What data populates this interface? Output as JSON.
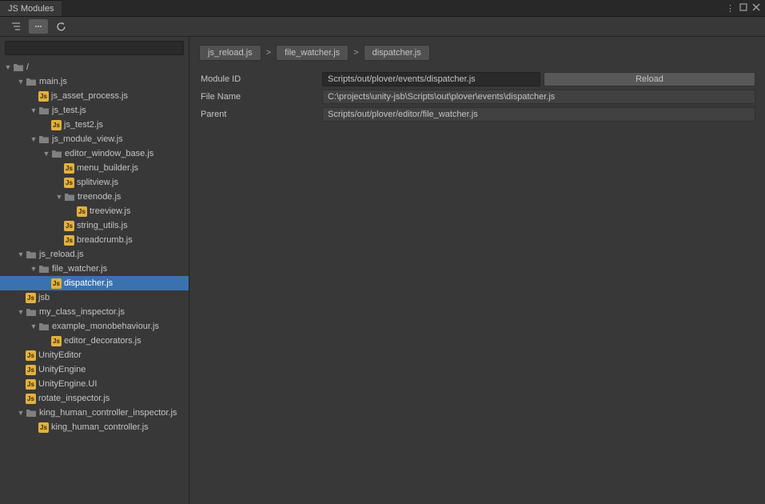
{
  "window": {
    "title": "JS Modules"
  },
  "breadcrumb": {
    "items": [
      "js_reload.js",
      "file_watcher.js",
      "dispatcher.js"
    ],
    "sep": ">"
  },
  "form": {
    "moduleIdLabel": "Module ID",
    "moduleId": "Scripts/out/plover/events/dispatcher.js",
    "reloadLabel": "Reload",
    "fileNameLabel": "File Name",
    "fileName": "C:\\projects\\unity-jsb\\Scripts\\out\\plover\\events\\dispatcher.js",
    "parentLabel": "Parent",
    "parent": "Scripts/out/plover/editor/file_watcher.js"
  },
  "tree": [
    {
      "depth": 0,
      "type": "folder",
      "label": "/",
      "expanded": true
    },
    {
      "depth": 1,
      "type": "folder",
      "label": "main.js",
      "expanded": true
    },
    {
      "depth": 2,
      "type": "js",
      "label": "js_asset_process.js"
    },
    {
      "depth": 2,
      "type": "folder",
      "label": "js_test.js",
      "expanded": true
    },
    {
      "depth": 3,
      "type": "js",
      "label": "js_test2.js"
    },
    {
      "depth": 2,
      "type": "folder",
      "label": "js_module_view.js",
      "expanded": true
    },
    {
      "depth": 3,
      "type": "folder",
      "label": "editor_window_base.js",
      "expanded": true
    },
    {
      "depth": 4,
      "type": "js",
      "label": "menu_builder.js"
    },
    {
      "depth": 4,
      "type": "js",
      "label": "splitview.js"
    },
    {
      "depth": 4,
      "type": "folder",
      "label": "treenode.js",
      "expanded": true
    },
    {
      "depth": 5,
      "type": "js",
      "label": "treeview.js"
    },
    {
      "depth": 4,
      "type": "js",
      "label": "string_utils.js"
    },
    {
      "depth": 4,
      "type": "js",
      "label": "breadcrumb.js"
    },
    {
      "depth": 1,
      "type": "folder",
      "label": "js_reload.js",
      "expanded": true
    },
    {
      "depth": 2,
      "type": "folder",
      "label": "file_watcher.js",
      "expanded": true
    },
    {
      "depth": 3,
      "type": "js",
      "label": "dispatcher.js",
      "selected": true
    },
    {
      "depth": 1,
      "type": "js",
      "label": "jsb"
    },
    {
      "depth": 1,
      "type": "folder",
      "label": "my_class_inspector.js",
      "expanded": true
    },
    {
      "depth": 2,
      "type": "folder",
      "label": "example_monobehaviour.js",
      "expanded": true
    },
    {
      "depth": 3,
      "type": "js",
      "label": "editor_decorators.js"
    },
    {
      "depth": 1,
      "type": "js",
      "label": "UnityEditor"
    },
    {
      "depth": 1,
      "type": "js",
      "label": "UnityEngine"
    },
    {
      "depth": 1,
      "type": "js",
      "label": "UnityEngine.UI"
    },
    {
      "depth": 1,
      "type": "js",
      "label": "rotate_inspector.js"
    },
    {
      "depth": 1,
      "type": "folder",
      "label": "king_human_controller_inspector.js",
      "expanded": true
    },
    {
      "depth": 2,
      "type": "js",
      "label": "king_human_controller.js"
    }
  ],
  "icons": {
    "jsBadge": "Js"
  }
}
